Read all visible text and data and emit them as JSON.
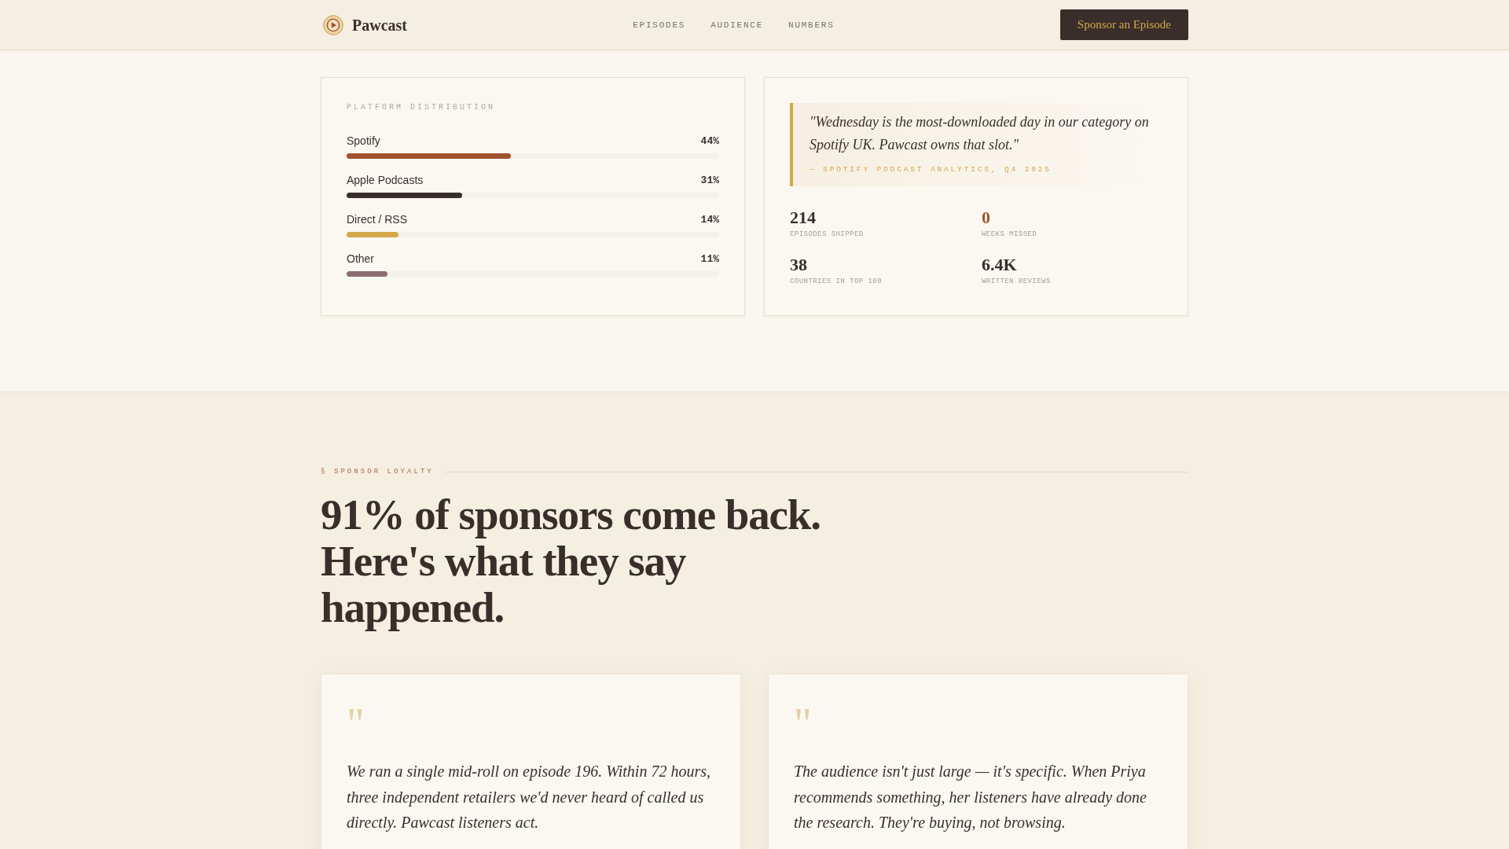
{
  "header": {
    "brand": "Pawcast",
    "nav": [
      {
        "label": "EPISODES"
      },
      {
        "label": "AUDIENCE"
      },
      {
        "label": "NUMBERS"
      }
    ],
    "cta": "Sponsor an Episode"
  },
  "platform_distribution": {
    "title": "PLATFORM DISTRIBUTION",
    "platforms": [
      {
        "name": "Spotify",
        "level": 0.44,
        "reading": "44%",
        "color": "#a0522d"
      },
      {
        "name": "Apple Podcasts",
        "level": 0.31,
        "reading": "31%",
        "color": "#3a2e2a"
      },
      {
        "name": "Direct / RSS",
        "level": 0.14,
        "reading": "14%",
        "color": "#d4a84a"
      },
      {
        "name": "Other",
        "level": 0.11,
        "reading": "11%",
        "color": "#8b6f6f"
      }
    ]
  },
  "highlight": {
    "quote": "\"Wednesday is the most-downloaded day in our category on Spotify UK. Pawcast owns that slot.\"",
    "attribution": "— SPOTIFY PODCAST ANALYTICS, Q4 2025",
    "stats": [
      {
        "value": "214",
        "label": "EPISODES SHIPPED",
        "color": "#3a2e2a"
      },
      {
        "value": "0",
        "label": "WEEKS MISSED",
        "color": "#a0522d"
      },
      {
        "value": "38",
        "label": "COUNTRIES IN TOP 100",
        "color": "#3a2e2a"
      },
      {
        "value": "6.4K",
        "label": "WRITTEN REVIEWS",
        "color": "#3a2e2a"
      }
    ]
  },
  "sponsor_loyalty": {
    "eyebrow": "§ SPONSOR LOYALTY",
    "heading": "91% of sponsors come back. Here's what they say happened.",
    "testimonials": [
      {
        "quote_mark": "\"",
        "text": "We ran a single mid-roll on episode 196. Within 72 hours, three independent retailers we'd never heard of called us directly. Pawcast listeners act."
      },
      {
        "quote_mark": "\"",
        "text": "The audience isn't just large — it's specific. When Priya recommends something, her listeners have already done the research. They're buying, not browsing."
      }
    ]
  }
}
